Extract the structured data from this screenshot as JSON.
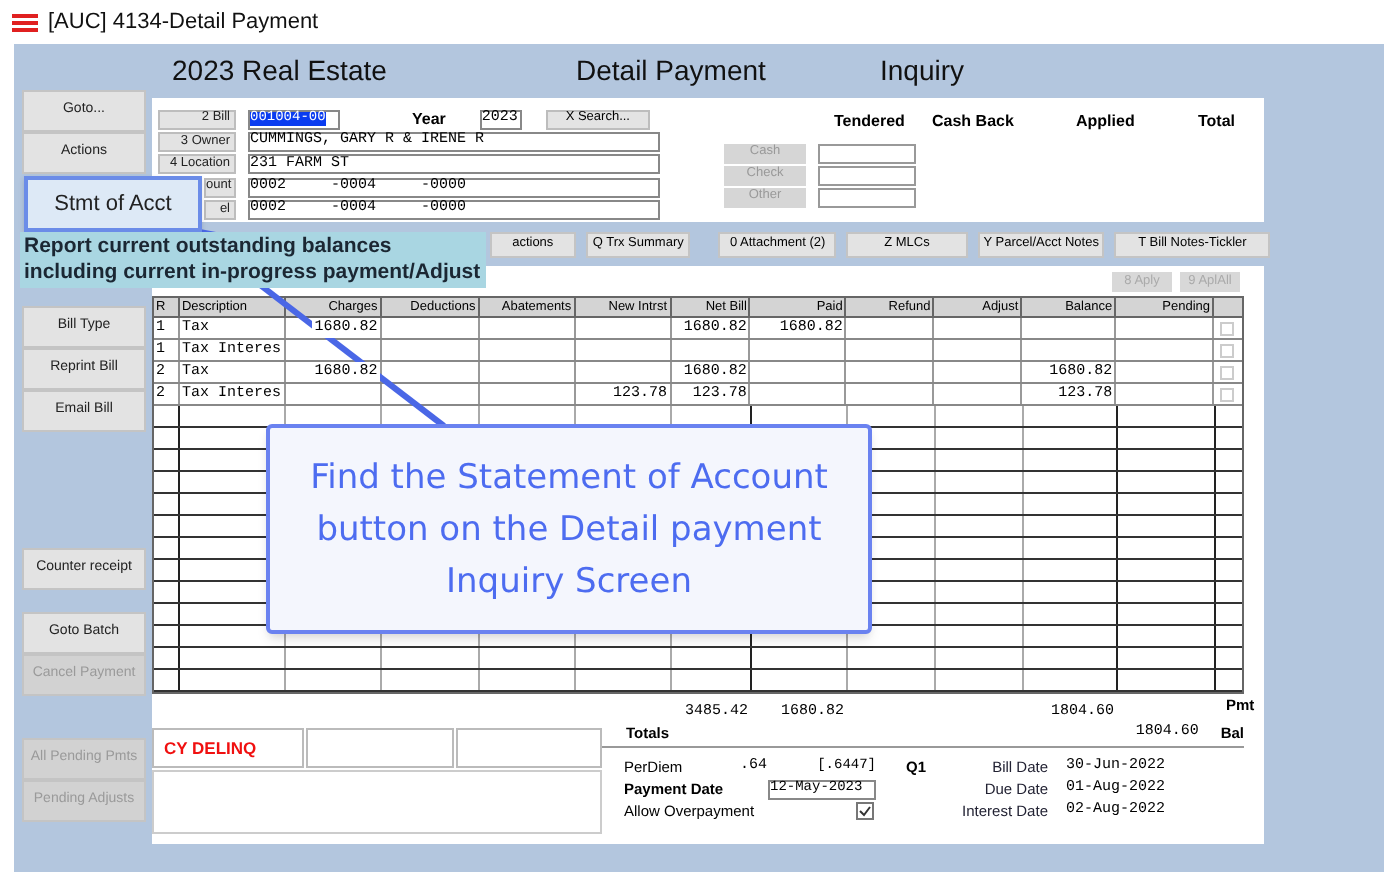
{
  "window": {
    "title": "[AUC] 4134-Detail Payment"
  },
  "sidebar": {
    "groups": [
      [
        {
          "label": "Goto...",
          "disabled": false
        },
        {
          "label": "Actions",
          "disabled": false
        }
      ],
      [
        {
          "label": "Bill Type",
          "disabled": false
        },
        {
          "label": "Reprint Bill",
          "disabled": false
        },
        {
          "label": "Email Bill",
          "disabled": false
        }
      ],
      [
        {
          "label": "Counter receipt",
          "disabled": false
        }
      ],
      [
        {
          "label": "Goto Batch",
          "disabled": false
        },
        {
          "label": "Cancel Payment",
          "disabled": true
        }
      ],
      [
        {
          "label": "All Pending Pmts",
          "disabled": true
        },
        {
          "label": "Pending Adjusts",
          "disabled": true
        }
      ]
    ]
  },
  "header": {
    "title": "2023 Real Estate",
    "screen": "Detail Payment",
    "mode": "Inquiry"
  },
  "form": {
    "fields": [
      {
        "label": "2 Bill",
        "value": "001004-00",
        "selected": true
      },
      {
        "label": "3 Owner",
        "value": "CUMMINGS, GARY R & IRENE R",
        "selected": false
      },
      {
        "label": "4 Location",
        "value": "231 FARM ST",
        "selected": false
      },
      {
        "label": "ount",
        "value": "0002     -0004     -0000",
        "selected": false
      },
      {
        "label": "el",
        "value": "0002     -0004     -0000",
        "selected": false
      }
    ],
    "year_label": "Year",
    "year": "2023",
    "search_button": "X Search...",
    "payment_columns": [
      "Tendered",
      "Cash Back",
      "Applied",
      "Total"
    ],
    "tender_buttons": [
      "Cash",
      "Check",
      "Other"
    ]
  },
  "toolbar": [
    "actions",
    "Q Trx Summary",
    "0 Attachment (2)",
    "Z MLCs",
    "Y Parcel/Acct Notes",
    "T Bill Notes-Tickler"
  ],
  "apply_buttons": [
    {
      "label": "8 Aply",
      "disabled": true
    },
    {
      "label": "9 AplAll",
      "disabled": true
    }
  ],
  "table": {
    "columns": [
      "R",
      "Description",
      "Charges",
      "Deductions",
      "Abatements",
      "New Intrst",
      "Net Bill",
      "Paid",
      "Refund",
      "Adjust",
      "Balance",
      "Pending"
    ],
    "rows": [
      {
        "r": "1",
        "description": "Tax",
        "charges": "1680.82",
        "net_bill": "1680.82",
        "paid": "1680.82",
        "checked": false
      },
      {
        "r": "1",
        "description": "Tax Interes",
        "checked": false
      },
      {
        "r": "2",
        "description": "Tax",
        "charges": "1680.82",
        "net_bill": "1680.82",
        "balance": "1680.82",
        "checked": false
      },
      {
        "r": "2",
        "description": "Tax Interes",
        "new_intrst": "123.78",
        "net_bill": "123.78",
        "balance": "123.78",
        "checked": false
      }
    ],
    "column_totals": {
      "net_bill": "3485.42",
      "paid": "1680.82",
      "balance": "1804.60"
    },
    "pmt_label": "Pmt"
  },
  "totals": {
    "label": "Totals",
    "balance": "1804.60",
    "bal_label": "Bal"
  },
  "flag": "CY DELINQ",
  "details": {
    "perdiem_label": "PerDiem",
    "perdiem": ".64",
    "perdiem_exact": "[.6447]",
    "payment_date_label": "Payment Date",
    "payment_date": "12-May-2023",
    "overpayment_label": "Allow Overpayment",
    "overpayment_checked": true,
    "quarter": "Q1",
    "dates": [
      {
        "label": "Bill Date",
        "value": "30-Jun-2022"
      },
      {
        "label": "Due Date",
        "value": "01-Aug-2022"
      },
      {
        "label": "Interest Date",
        "value": "02-Aug-2022"
      }
    ]
  },
  "highlight_button": {
    "label": "Stmt of Acct"
  },
  "tooltip": {
    "lines": [
      "Report current outstanding balances",
      "including current in-progress payment/Adjust"
    ]
  },
  "callout": {
    "text": "Find the Statement of Account button on the Detail payment Inquiry Screen"
  }
}
